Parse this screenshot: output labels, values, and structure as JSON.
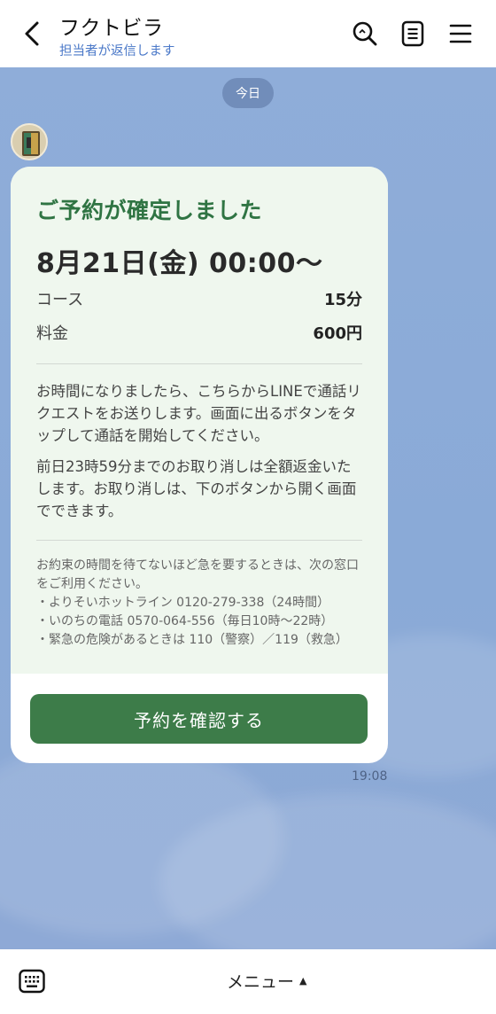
{
  "header": {
    "title": "フクトビラ",
    "subtitle": "担当者が返信します",
    "icons": [
      "back-icon",
      "search-icon",
      "notes-icon",
      "hamburger-icon"
    ]
  },
  "chat": {
    "date_label": "今日",
    "message_time": "19:08",
    "card": {
      "heading": "ご予約が確定しました",
      "datetime": "8月21日(金) 00:00〜",
      "rows": [
        {
          "label": "コース",
          "value": "15分"
        },
        {
          "label": "料金",
          "value": "600円"
        }
      ],
      "paragraph1": "お時間になりましたら、こちらからLINEで通話リクエストをお送りします。画面に出るボタンをタップして通話を開始してください。",
      "paragraph2": "前日23時59分までのお取り消しは全額返金いたします。お取り消しは、下のボタンから開く画面でできます。",
      "note_intro": "お約束の時間を待てないほど急を要するときは、次の窓口をご利用ください。",
      "note_items": [
        "・よりそいホットライン 0120-279-338（24時間）",
        "・いのちの電話 0570-064-556（毎日10時〜22時）",
        "・緊急の危険があるときは 110（警察）／119（救急）"
      ],
      "button_label": "予約を確認する"
    }
  },
  "footer": {
    "menu_label": "メニュー",
    "menu_caret": "▲",
    "keyboard_icon": "keyboard-icon"
  },
  "colors": {
    "accent_green": "#3d7c49",
    "heading_green": "#2f7443",
    "chat_background": "#8aaad7",
    "subtitle_blue": "#4a78c8"
  }
}
